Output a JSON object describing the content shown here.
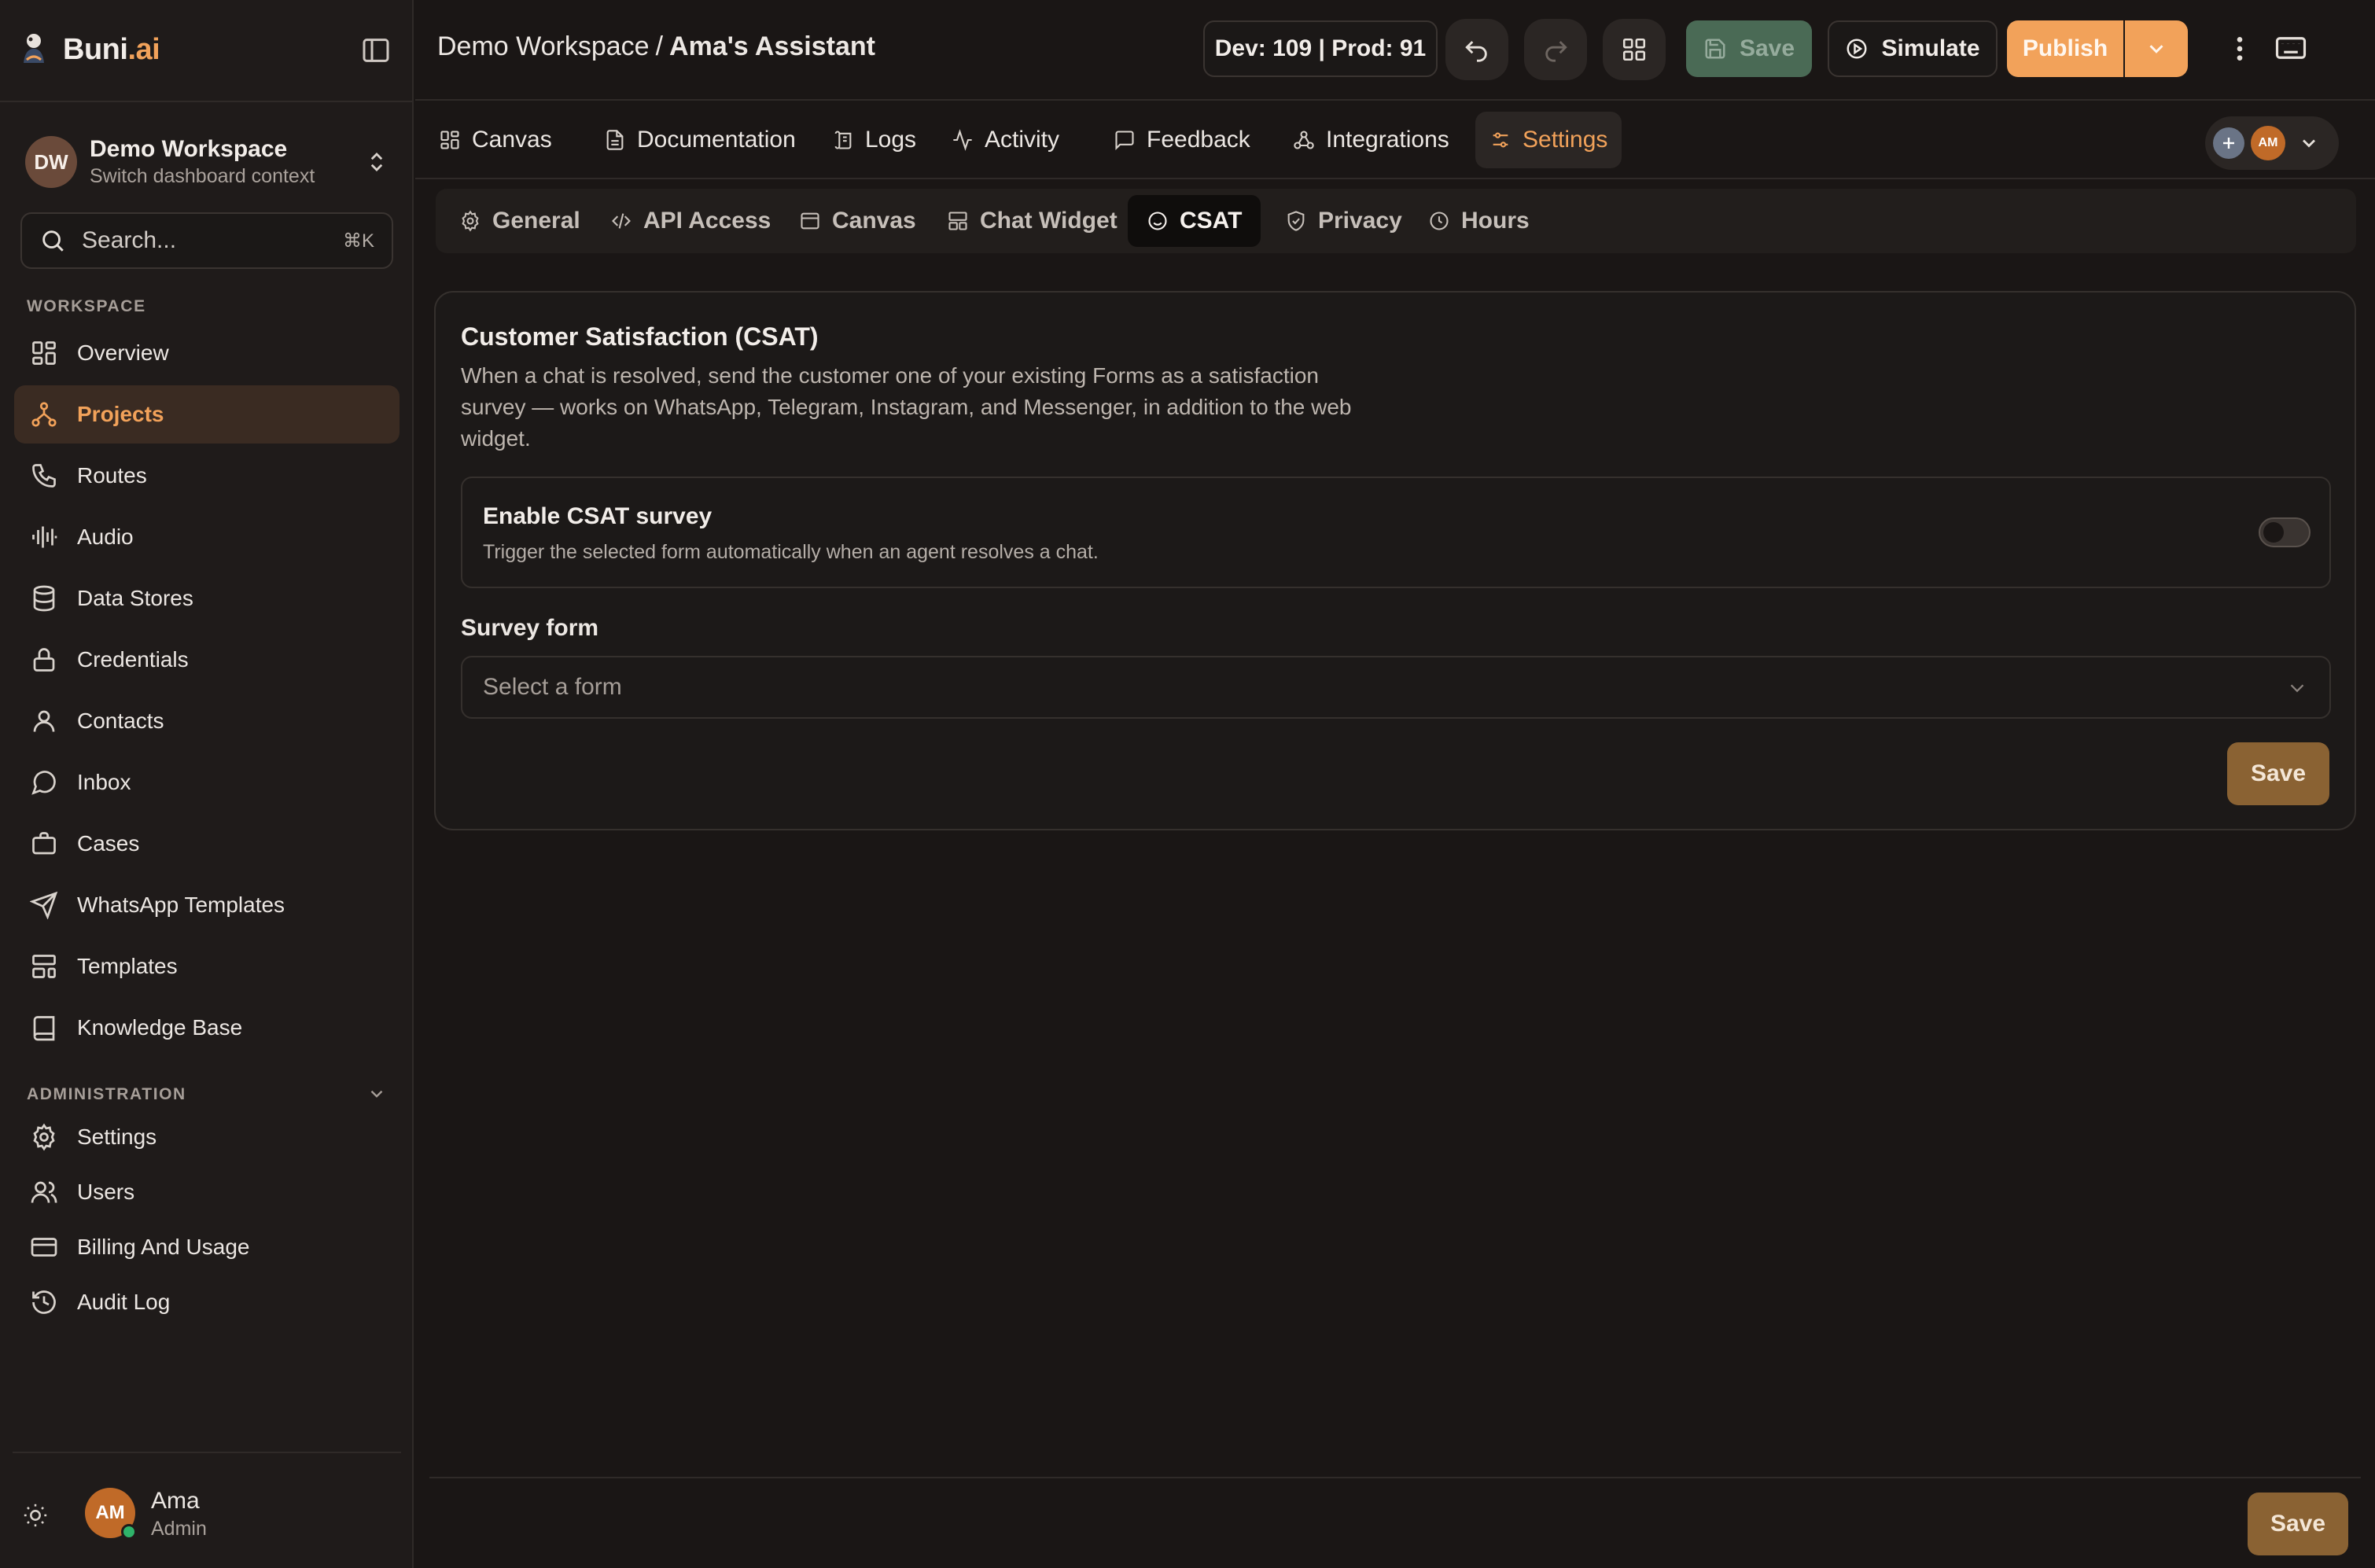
{
  "brand": {
    "name_main": "Buni",
    "name_accent": ".ai"
  },
  "workspace": {
    "initials": "DW",
    "name": "Demo Workspace",
    "subtitle": "Switch dashboard context"
  },
  "search": {
    "placeholder": "Search...",
    "shortcut": "⌘K"
  },
  "sidebar": {
    "workspace_heading": "WORKSPACE",
    "workspace_items": [
      {
        "label": "Overview",
        "icon": "layout-grid-icon",
        "active": false
      },
      {
        "label": "Projects",
        "icon": "workflow-icon",
        "active": true
      },
      {
        "label": "Routes",
        "icon": "phone-icon",
        "active": false
      },
      {
        "label": "Audio",
        "icon": "audio-waveform-icon",
        "active": false
      },
      {
        "label": "Data Stores",
        "icon": "database-icon",
        "active": false
      },
      {
        "label": "Credentials",
        "icon": "lock-icon",
        "active": false
      },
      {
        "label": "Contacts",
        "icon": "user-icon",
        "active": false
      },
      {
        "label": "Inbox",
        "icon": "message-circle-icon",
        "active": false
      },
      {
        "label": "Cases",
        "icon": "briefcase-icon",
        "active": false
      },
      {
        "label": "WhatsApp Templates",
        "icon": "send-icon",
        "active": false
      },
      {
        "label": "Templates",
        "icon": "layout-template-icon",
        "active": false
      },
      {
        "label": "Knowledge Base",
        "icon": "book-icon",
        "active": false
      }
    ],
    "admin_heading": "ADMINISTRATION",
    "admin_items": [
      {
        "label": "Settings",
        "icon": "gear-icon"
      },
      {
        "label": "Users",
        "icon": "users-icon"
      },
      {
        "label": "Billing And Usage",
        "icon": "credit-card-icon"
      },
      {
        "label": "Audit Log",
        "icon": "history-icon"
      }
    ]
  },
  "user": {
    "initials": "AM",
    "name": "Ama",
    "role": "Admin"
  },
  "topbar": {
    "breadcrumb_workspace": "Demo Workspace",
    "breadcrumb_sep": "/",
    "breadcrumb_assistant": "Ama's Assistant",
    "env_badge": "Dev: 109 | Prod: 91",
    "save_label": "Save",
    "simulate_label": "Simulate",
    "publish_label": "Publish"
  },
  "tabs": [
    {
      "label": "Canvas",
      "icon": "layout-grid-icon",
      "active": false
    },
    {
      "label": "Documentation",
      "icon": "file-text-icon",
      "active": false
    },
    {
      "label": "Logs",
      "icon": "scroll-icon",
      "active": false
    },
    {
      "label": "Activity",
      "icon": "activity-icon",
      "active": false
    },
    {
      "label": "Feedback",
      "icon": "message-square-icon",
      "active": false
    },
    {
      "label": "Integrations",
      "icon": "webhook-icon",
      "active": false
    },
    {
      "label": "Settings",
      "icon": "sliders-icon",
      "active": true
    }
  ],
  "tab_actions": {
    "avatar_initials": "AM"
  },
  "subtabs": [
    {
      "label": "General",
      "icon": "gear-icon",
      "active": false
    },
    {
      "label": "API Access",
      "icon": "code-icon",
      "active": false
    },
    {
      "label": "Canvas",
      "icon": "panel-icon",
      "active": false
    },
    {
      "label": "Chat Widget",
      "icon": "layout-icon",
      "active": false
    },
    {
      "label": "CSAT",
      "icon": "smile-icon",
      "active": true
    },
    {
      "label": "Privacy",
      "icon": "shield-check-icon",
      "active": false
    },
    {
      "label": "Hours",
      "icon": "clock-icon",
      "active": false
    }
  ],
  "csat": {
    "title": "Customer Satisfaction (CSAT)",
    "description": "When a chat is resolved, send the customer one of your existing Forms as a satisfaction survey — works on WhatsApp, Telegram, Instagram, and Messenger, in addition to the web widget.",
    "toggle_title": "Enable CSAT survey",
    "toggle_subtitle": "Trigger the selected form automatically when an agent resolves a chat.",
    "toggle_enabled": false,
    "field_label": "Survey form",
    "select_placeholder": "Select a form",
    "save_label": "Save"
  },
  "footer": {
    "save_label": "Save"
  },
  "colors": {
    "accent": "#f2a25a",
    "background": "#1a1615",
    "sidebar": "#1f1b1a",
    "save_brown": "#8a6233",
    "save_green_disabled": "#4a6a55"
  }
}
